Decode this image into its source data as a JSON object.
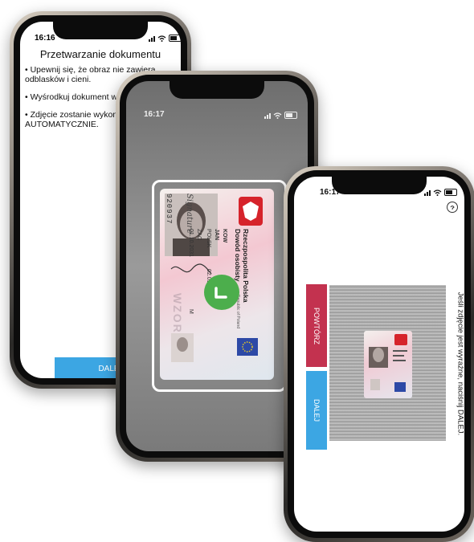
{
  "screen1": {
    "time": "16:16",
    "title": "Przetwarzanie dokumentu",
    "bullets": [
      "• Upewnij się, że obraz nie zawiera\nodblasków i cieni.",
      "• Wyśrodkuj dokument w ram",
      "• Zdjęcie zostanie wykonane\nAUTOMATYCZNIE."
    ],
    "next_label": "DALEJ"
  },
  "screen2": {
    "time": "16:17",
    "card": {
      "header_line1": "Rzeczpospolita Polska",
      "header_line2": "Dowód osobisty",
      "subheader": "Republic of Poland",
      "surname_partial": "KOW",
      "given_partial": "JAN",
      "nationality_partial": "POLSK",
      "birthdate": "02.01.1981",
      "document_partial": "ZAC",
      "expiry_partial": "01.10.2031",
      "sex": "M",
      "signature": "Signature",
      "card_number_partial": "920937",
      "watermark": "WZOR"
    }
  },
  "screen3": {
    "time": "16:17",
    "retry_label": "POWTÓRZ",
    "next_label": "DALEJ",
    "instruction": "Jeśli zdjęcie jest wyraźne, naciśnij DALEJ."
  }
}
